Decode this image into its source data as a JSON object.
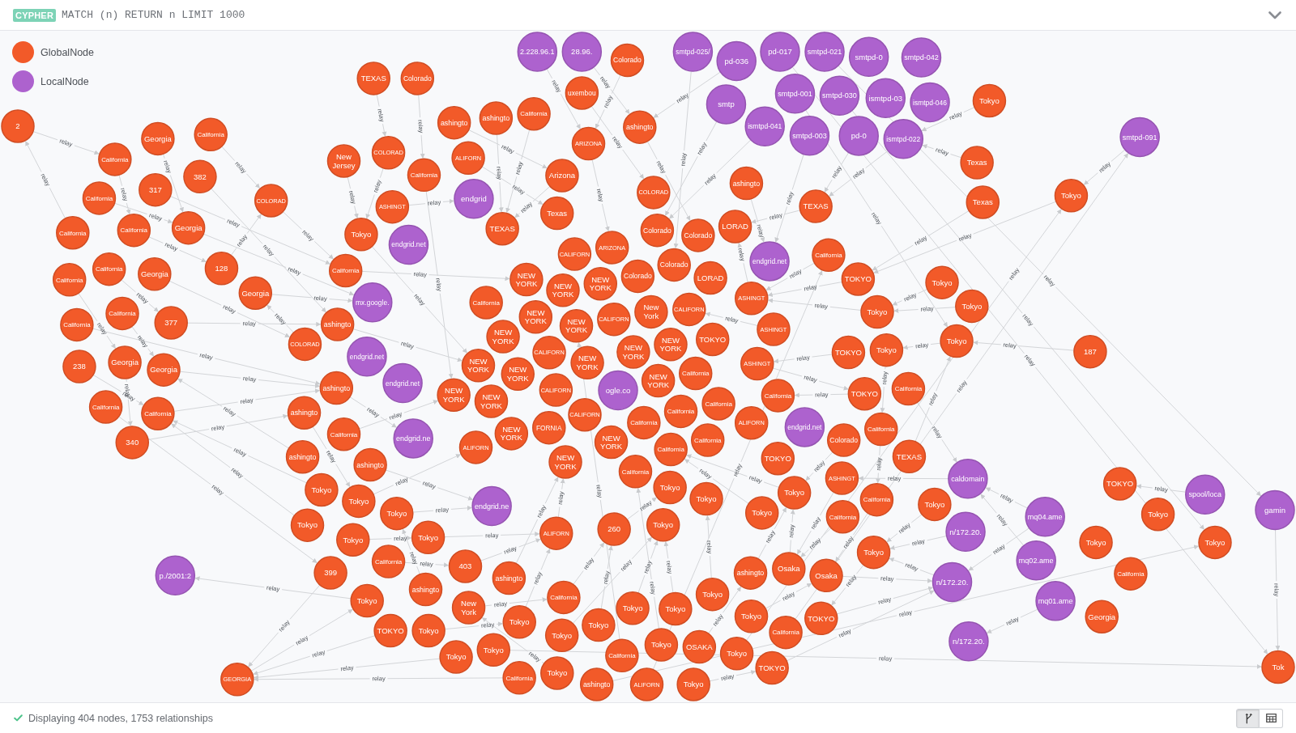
{
  "editor": {
    "badge": "CYPHER",
    "query": "MATCH (n) RETURN n LIMIT 1000"
  },
  "legend": [
    {
      "label": "GlobalNode",
      "kind": "global",
      "color": "#f25a29"
    },
    {
      "label": "LocalNode",
      "kind": "local",
      "color": "#ad62ce"
    }
  ],
  "graph": {
    "nodes": [
      {
        "label": "2",
        "kind": "global"
      },
      {
        "label": "TEXAS",
        "kind": "global"
      },
      {
        "label": "Colorado",
        "kind": "global"
      },
      {
        "label": "Georgia",
        "kind": "global"
      },
      {
        "label": "California",
        "kind": "global"
      },
      {
        "label": "California",
        "kind": "global"
      },
      {
        "label": "382",
        "kind": "global"
      },
      {
        "label": "317",
        "kind": "global"
      },
      {
        "label": "COLORAD",
        "kind": "global"
      },
      {
        "label": "New Jersey",
        "kind": "global"
      },
      {
        "label": "COLORAD",
        "kind": "global"
      },
      {
        "label": "California",
        "kind": "global"
      },
      {
        "label": "California",
        "kind": "global"
      },
      {
        "label": "California",
        "kind": "global"
      },
      {
        "label": "California",
        "kind": "global"
      },
      {
        "label": "Georgia",
        "kind": "global"
      },
      {
        "label": "California",
        "kind": "global"
      },
      {
        "label": "Georgia",
        "kind": "global"
      },
      {
        "label": "128",
        "kind": "global"
      },
      {
        "label": "California",
        "kind": "global"
      },
      {
        "label": "Georgia",
        "kind": "global"
      },
      {
        "label": "California",
        "kind": "global"
      },
      {
        "label": "California",
        "kind": "global"
      },
      {
        "label": "377",
        "kind": "global"
      },
      {
        "label": "Tokyo",
        "kind": "global"
      },
      {
        "label": "ASHINGT",
        "kind": "global"
      },
      {
        "label": "California",
        "kind": "global"
      },
      {
        "label": "ashingto",
        "kind": "global"
      },
      {
        "label": "COLORAD",
        "kind": "global"
      },
      {
        "label": "238",
        "kind": "global"
      },
      {
        "label": "Georgia",
        "kind": "global"
      },
      {
        "label": "Georgia",
        "kind": "global"
      },
      {
        "label": "California",
        "kind": "global"
      },
      {
        "label": "California",
        "kind": "global"
      },
      {
        "label": "340",
        "kind": "global"
      },
      {
        "label": "Colorado",
        "kind": "global"
      },
      {
        "label": "uxembou",
        "kind": "global"
      },
      {
        "label": "ashingto",
        "kind": "global"
      },
      {
        "label": "ashingto",
        "kind": "global"
      },
      {
        "label": "California",
        "kind": "global"
      },
      {
        "label": "ashingto",
        "kind": "global"
      },
      {
        "label": "ALIFORN",
        "kind": "global"
      },
      {
        "label": "ARIZONA",
        "kind": "global"
      },
      {
        "label": "Arizona",
        "kind": "global"
      },
      {
        "label": "Texas",
        "kind": "global"
      },
      {
        "label": "TEXAS",
        "kind": "global"
      },
      {
        "label": "ARIZONA",
        "kind": "global"
      },
      {
        "label": "COLORAD",
        "kind": "global"
      },
      {
        "label": "Colorado",
        "kind": "global"
      },
      {
        "label": "Colorado",
        "kind": "global"
      },
      {
        "label": "LORAD",
        "kind": "global"
      },
      {
        "label": "Colorado",
        "kind": "global"
      },
      {
        "label": "Colorado",
        "kind": "global"
      },
      {
        "label": "LORAD",
        "kind": "global"
      },
      {
        "label": "ashingto",
        "kind": "global"
      },
      {
        "label": "TEXAS",
        "kind": "global"
      },
      {
        "label": "California",
        "kind": "global"
      },
      {
        "label": "TOKYO",
        "kind": "global"
      },
      {
        "label": "ASHINGT",
        "kind": "global"
      },
      {
        "label": "ASHINGT",
        "kind": "global"
      },
      {
        "label": "ASHINGT",
        "kind": "global"
      },
      {
        "label": "Tokyo",
        "kind": "global"
      },
      {
        "label": "Tokyo",
        "kind": "global"
      },
      {
        "label": "Texas",
        "kind": "global"
      },
      {
        "label": "Texas",
        "kind": "global"
      },
      {
        "label": "Tokyo",
        "kind": "global"
      },
      {
        "label": "Tokyo",
        "kind": "global"
      },
      {
        "label": "Tokyo",
        "kind": "global"
      },
      {
        "label": "Tokyo",
        "kind": "global"
      },
      {
        "label": "TOKYO",
        "kind": "global"
      },
      {
        "label": "Tokyo",
        "kind": "global"
      },
      {
        "label": "187",
        "kind": "global"
      },
      {
        "label": "TOKYO",
        "kind": "global"
      },
      {
        "label": "California",
        "kind": "global"
      },
      {
        "label": "CALIFORN",
        "kind": "global"
      },
      {
        "label": "NEW YORK",
        "kind": "global"
      },
      {
        "label": "NEW YORK",
        "kind": "global"
      },
      {
        "label": "NEW YORK",
        "kind": "global"
      },
      {
        "label": "California",
        "kind": "global"
      },
      {
        "label": "New York",
        "kind": "global"
      },
      {
        "label": "NEW YORK",
        "kind": "global"
      },
      {
        "label": "NEW YORK",
        "kind": "global"
      },
      {
        "label": "CALIFORN",
        "kind": "global"
      },
      {
        "label": "NEW YORK",
        "kind": "global"
      },
      {
        "label": "CALIFORN",
        "kind": "global"
      },
      {
        "label": "NEW YORK",
        "kind": "global"
      },
      {
        "label": "NEW YORK",
        "kind": "global"
      },
      {
        "label": "NEW YORK",
        "kind": "global"
      },
      {
        "label": "NEW YORK",
        "kind": "global"
      },
      {
        "label": "CALIFORN",
        "kind": "global"
      },
      {
        "label": "TOKYO",
        "kind": "global"
      },
      {
        "label": "California",
        "kind": "global"
      },
      {
        "label": "NEW YORK",
        "kind": "global"
      },
      {
        "label": "NEW YORK",
        "kind": "global"
      },
      {
        "label": "CALIFORN",
        "kind": "global"
      },
      {
        "label": "NEW YORK",
        "kind": "global"
      },
      {
        "label": "NEW YORK",
        "kind": "global"
      },
      {
        "label": "California",
        "kind": "global"
      },
      {
        "label": "NEW YORK",
        "kind": "global"
      },
      {
        "label": "FORNIA",
        "kind": "global"
      },
      {
        "label": "NEW YORK",
        "kind": "global"
      },
      {
        "label": "CALIFORN",
        "kind": "global"
      },
      {
        "label": "California",
        "kind": "global"
      },
      {
        "label": "California",
        "kind": "global"
      },
      {
        "label": "ALIFORN",
        "kind": "global"
      },
      {
        "label": "NEW YORK",
        "kind": "global"
      },
      {
        "label": "California",
        "kind": "global"
      },
      {
        "label": "California",
        "kind": "global"
      },
      {
        "label": "California",
        "kind": "global"
      },
      {
        "label": "Tokyo",
        "kind": "global"
      },
      {
        "label": "ALIFORN",
        "kind": "global"
      },
      {
        "label": "California",
        "kind": "global"
      },
      {
        "label": "TOKYO",
        "kind": "global"
      },
      {
        "label": "Tokyo",
        "kind": "global"
      },
      {
        "label": "ALIFORN",
        "kind": "global"
      },
      {
        "label": "260",
        "kind": "global"
      },
      {
        "label": "Tokyo",
        "kind": "global"
      },
      {
        "label": "ashingto",
        "kind": "global"
      },
      {
        "label": "ashingto",
        "kind": "global"
      },
      {
        "label": "California",
        "kind": "global"
      },
      {
        "label": "ashingto",
        "kind": "global"
      },
      {
        "label": "ashingto",
        "kind": "global"
      },
      {
        "label": "Tokyo",
        "kind": "global"
      },
      {
        "label": "Tokyo",
        "kind": "global"
      },
      {
        "label": "Tokyo",
        "kind": "global"
      },
      {
        "label": "Tokyo",
        "kind": "global"
      },
      {
        "label": "Tokyo",
        "kind": "global"
      },
      {
        "label": "Tokyo",
        "kind": "global"
      },
      {
        "label": "California",
        "kind": "global"
      },
      {
        "label": "399",
        "kind": "global"
      },
      {
        "label": "403",
        "kind": "global"
      },
      {
        "label": "ashingto",
        "kind": "global"
      },
      {
        "label": "ashingto",
        "kind": "global"
      },
      {
        "label": "Tokyo",
        "kind": "global"
      },
      {
        "label": "New York",
        "kind": "global"
      },
      {
        "label": "TOKYO",
        "kind": "global"
      },
      {
        "label": "Tokyo",
        "kind": "global"
      },
      {
        "label": "Tokyo",
        "kind": "global"
      },
      {
        "label": "California",
        "kind": "global"
      },
      {
        "label": "Tokyo",
        "kind": "global"
      },
      {
        "label": "Tokyo",
        "kind": "global"
      },
      {
        "label": "Tokyo",
        "kind": "global"
      },
      {
        "label": "Tokyo",
        "kind": "global"
      },
      {
        "label": "Tokyo",
        "kind": "global"
      },
      {
        "label": "Tokyo",
        "kind": "global"
      },
      {
        "label": "Tokyo",
        "kind": "global"
      },
      {
        "label": "California",
        "kind": "global"
      },
      {
        "label": "ashingto",
        "kind": "global"
      },
      {
        "label": "ALIFORN",
        "kind": "global"
      },
      {
        "label": "Tokyo",
        "kind": "global"
      },
      {
        "label": "Tokyo",
        "kind": "global"
      },
      {
        "label": "California",
        "kind": "global"
      },
      {
        "label": "Tokyo",
        "kind": "global"
      },
      {
        "label": "OSAKA",
        "kind": "global"
      },
      {
        "label": "Tokyo",
        "kind": "global"
      },
      {
        "label": "TOKYO",
        "kind": "global"
      },
      {
        "label": "Tokyo",
        "kind": "global"
      },
      {
        "label": "California",
        "kind": "global"
      },
      {
        "label": "TOKYO",
        "kind": "global"
      },
      {
        "label": "ashingto",
        "kind": "global"
      },
      {
        "label": "Osaka",
        "kind": "global"
      },
      {
        "label": "Osaka",
        "kind": "global"
      },
      {
        "label": "Tokyo",
        "kind": "global"
      },
      {
        "label": "Tokyo",
        "kind": "global"
      },
      {
        "label": "GEORGIA",
        "kind": "global"
      },
      {
        "label": "Colorado",
        "kind": "global"
      },
      {
        "label": "California",
        "kind": "global"
      },
      {
        "label": "TEXAS",
        "kind": "global"
      },
      {
        "label": "ASHINGT",
        "kind": "global"
      },
      {
        "label": "California",
        "kind": "global"
      },
      {
        "label": "California",
        "kind": "global"
      },
      {
        "label": "Tokyo",
        "kind": "global"
      },
      {
        "label": "Tokyo",
        "kind": "global"
      },
      {
        "label": "TOKYO",
        "kind": "global"
      },
      {
        "label": "Tokyo",
        "kind": "global"
      },
      {
        "label": "Tokyo",
        "kind": "global"
      },
      {
        "label": "Tokyo",
        "kind": "global"
      },
      {
        "label": "California",
        "kind": "global"
      },
      {
        "label": "Georgia",
        "kind": "global"
      },
      {
        "label": "Tok",
        "kind": "global"
      },
      {
        "label": "2.228.96.1",
        "kind": "local"
      },
      {
        "label": "28.96.",
        "kind": "local"
      },
      {
        "label": "smtpd-025/",
        "kind": "local"
      },
      {
        "label": "pd-036",
        "kind": "local"
      },
      {
        "label": "pd-017",
        "kind": "local"
      },
      {
        "label": "smtpd-021",
        "kind": "local"
      },
      {
        "label": "smtpd-0",
        "kind": "local"
      },
      {
        "label": "smtpd-042",
        "kind": "local"
      },
      {
        "label": "smtp",
        "kind": "local"
      },
      {
        "label": "smtpd-001",
        "kind": "local"
      },
      {
        "label": "ismtpd-041",
        "kind": "local"
      },
      {
        "label": "smtpd-030",
        "kind": "local"
      },
      {
        "label": "ismtpd-03",
        "kind": "local"
      },
      {
        "label": "ismtpd-046",
        "kind": "local"
      },
      {
        "label": "smtpd-003",
        "kind": "local"
      },
      {
        "label": "pd-0",
        "kind": "local"
      },
      {
        "label": "ismtpd-022",
        "kind": "local"
      },
      {
        "label": "smtpd-091",
        "kind": "local"
      },
      {
        "label": "endgrid",
        "kind": "local"
      },
      {
        "label": "endgrid.net",
        "kind": "local"
      },
      {
        "label": "mx.google.",
        "kind": "local"
      },
      {
        "label": "endgrid.net",
        "kind": "local"
      },
      {
        "label": "endgrid.net",
        "kind": "local"
      },
      {
        "label": "endgrid.net",
        "kind": "local"
      },
      {
        "label": "ogle.co",
        "kind": "local"
      },
      {
        "label": "endgrid.net",
        "kind": "local"
      },
      {
        "label": "endgrid.ne",
        "kind": "local"
      },
      {
        "label": "endgrid.ne",
        "kind": "local"
      },
      {
        "label": "p./2001:2",
        "kind": "local"
      },
      {
        "label": "caldomain",
        "kind": "local"
      },
      {
        "label": "n/172.20.",
        "kind": "local"
      },
      {
        "label": "mq04.ame",
        "kind": "local"
      },
      {
        "label": "mq02.ame",
        "kind": "local"
      },
      {
        "label": "n/172.20.",
        "kind": "local"
      },
      {
        "label": "mq01.ame",
        "kind": "local"
      },
      {
        "label": "n/172.20.",
        "kind": "local"
      },
      {
        "label": "spool/loca",
        "kind": "local"
      },
      {
        "label": "gamin",
        "kind": "local"
      }
    ],
    "relationships": [
      {
        "type": "relay"
      },
      {
        "type": "relay"
      },
      {
        "type": "relay"
      },
      {
        "type": "relay"
      },
      {
        "type": "relay"
      },
      {
        "type": "relay"
      },
      {
        "type": "relay"
      },
      {
        "type": "relay"
      },
      {
        "type": "relay"
      },
      {
        "type": "relay"
      },
      {
        "type": "relay"
      },
      {
        "type": "relay"
      },
      {
        "type": "relay"
      },
      {
        "type": "relay"
      },
      {
        "type": "relay"
      },
      {
        "type": "relay"
      },
      {
        "type": "relay"
      },
      {
        "type": "relay"
      },
      {
        "type": "relay"
      },
      {
        "type": "relay"
      },
      {
        "type": "relay"
      },
      {
        "type": "relay"
      },
      {
        "type": "relay"
      },
      {
        "type": "relay"
      },
      {
        "type": "relay"
      },
      {
        "type": "relay"
      },
      {
        "type": "relay"
      },
      {
        "type": "relay"
      },
      {
        "type": "relay"
      },
      {
        "type": "relay"
      },
      {
        "type": "relay"
      },
      {
        "type": "relay"
      },
      {
        "type": "relay"
      },
      {
        "type": "relay"
      },
      {
        "type": "relay"
      },
      {
        "type": "relay"
      },
      {
        "type": "relay"
      },
      {
        "type": "relay"
      },
      {
        "type": "relay"
      },
      {
        "type": "relay"
      },
      {
        "type": "relay"
      },
      {
        "type": "relay"
      },
      {
        "type": "relay"
      },
      {
        "type": "relay"
      },
      {
        "type": "relay"
      },
      {
        "type": "relay"
      },
      {
        "type": "relay"
      },
      {
        "type": "relay"
      },
      {
        "type": "relay"
      },
      {
        "type": "relay"
      },
      {
        "type": "relay"
      },
      {
        "type": "relay"
      },
      {
        "type": "relay"
      },
      {
        "type": "relay"
      },
      {
        "type": "relay"
      },
      {
        "type": "relay"
      },
      {
        "type": "relay"
      },
      {
        "type": "relay"
      },
      {
        "type": "relay"
      },
      {
        "type": "relay"
      },
      {
        "type": "relay"
      },
      {
        "type": "relay"
      },
      {
        "type": "relay"
      },
      {
        "type": "relay"
      },
      {
        "type": "relay"
      },
      {
        "type": "relay"
      },
      {
        "type": "relay"
      },
      {
        "type": "relay"
      },
      {
        "type": "relay"
      },
      {
        "type": "relay"
      },
      {
        "type": "relay"
      },
      {
        "type": "relay"
      },
      {
        "type": "relay"
      },
      {
        "type": "relay"
      },
      {
        "type": "relay"
      },
      {
        "type": "relay"
      },
      {
        "type": "relay"
      },
      {
        "type": "relay"
      },
      {
        "type": "relay"
      },
      {
        "type": "relay"
      },
      {
        "type": "relay"
      },
      {
        "type": "relay"
      },
      {
        "type": "relay"
      },
      {
        "type": "relay"
      },
      {
        "type": "relay"
      },
      {
        "type": "relay"
      },
      {
        "type": "relay"
      },
      {
        "type": "relay"
      },
      {
        "type": "relay"
      },
      {
        "type": "relay"
      },
      {
        "type": "relay"
      },
      {
        "type": "relay"
      },
      {
        "type": "relay"
      },
      {
        "type": "relay"
      },
      {
        "type": "relay"
      },
      {
        "type": "relay"
      },
      {
        "type": "relay"
      },
      {
        "type": "relay"
      },
      {
        "type": "relay"
      },
      {
        "type": "relay"
      },
      {
        "type": "relay"
      },
      {
        "type": "relay"
      },
      {
        "type": "relay"
      },
      {
        "type": "relay"
      },
      {
        "type": "relay"
      },
      {
        "type": "relay"
      },
      {
        "type": "relay"
      },
      {
        "type": "relay"
      },
      {
        "type": "relay"
      },
      {
        "type": "relay"
      },
      {
        "type": "relay"
      },
      {
        "type": "relay"
      },
      {
        "type": "relay"
      },
      {
        "type": "relay"
      },
      {
        "type": "relay"
      },
      {
        "type": "relay"
      },
      {
        "type": "relay"
      },
      {
        "type": "relay"
      },
      {
        "type": "relay"
      },
      {
        "type": "relay"
      },
      {
        "type": "relay"
      },
      {
        "type": "relay"
      },
      {
        "type": "relay"
      },
      {
        "type": "relay"
      },
      {
        "type": "relay"
      },
      {
        "type": "relay"
      },
      {
        "type": "relay"
      },
      {
        "type": "relay"
      },
      {
        "type": "relay"
      },
      {
        "type": "relay"
      },
      {
        "type": "relay"
      },
      {
        "type": "relay"
      },
      {
        "type": "relay"
      },
      {
        "type": "relay"
      },
      {
        "type": "relay"
      },
      {
        "type": "relay"
      },
      {
        "type": "relay"
      },
      {
        "type": "relay"
      },
      {
        "type": "relay"
      },
      {
        "type": "relay"
      },
      {
        "type": "relay"
      },
      {
        "type": "relay"
      },
      {
        "type": "relay"
      },
      {
        "type": "relay"
      },
      {
        "type": "relay"
      }
    ]
  },
  "status_bar": {
    "message": "Displaying 404 nodes, 1753 relationships"
  },
  "view_buttons": [
    {
      "kind": "graph",
      "selected": true
    },
    {
      "kind": "table",
      "selected": false
    }
  ]
}
